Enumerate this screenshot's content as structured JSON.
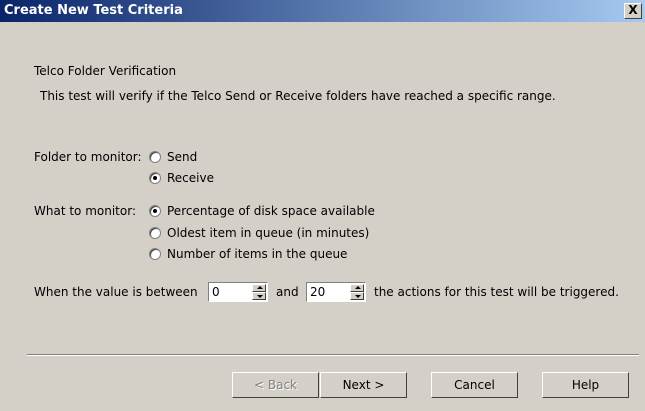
{
  "window": {
    "title": "Create New Test Criteria",
    "close_label": "X"
  },
  "header": {
    "heading": "Telco Folder Verification",
    "description": "This test will verify if the Telco Send or Receive folders have reached a specific range."
  },
  "folder": {
    "label": "Folder to monitor:",
    "options": [
      {
        "label": "Send",
        "selected": false
      },
      {
        "label": "Receive",
        "selected": true
      }
    ]
  },
  "monitor": {
    "label": "What to monitor:",
    "options": [
      {
        "label": "Percentage of disk space available",
        "selected": true
      },
      {
        "label": "Oldest item in queue (in minutes)",
        "selected": false
      },
      {
        "label": "Number of items in the queue",
        "selected": false
      }
    ]
  },
  "range": {
    "prefix": "When the value is between",
    "min_value": "0",
    "middle": "and",
    "max_value": "20",
    "suffix": "the actions for this test will be triggered."
  },
  "buttons": {
    "back": "< Back",
    "next": "Next >",
    "cancel": "Cancel",
    "help": "Help"
  }
}
